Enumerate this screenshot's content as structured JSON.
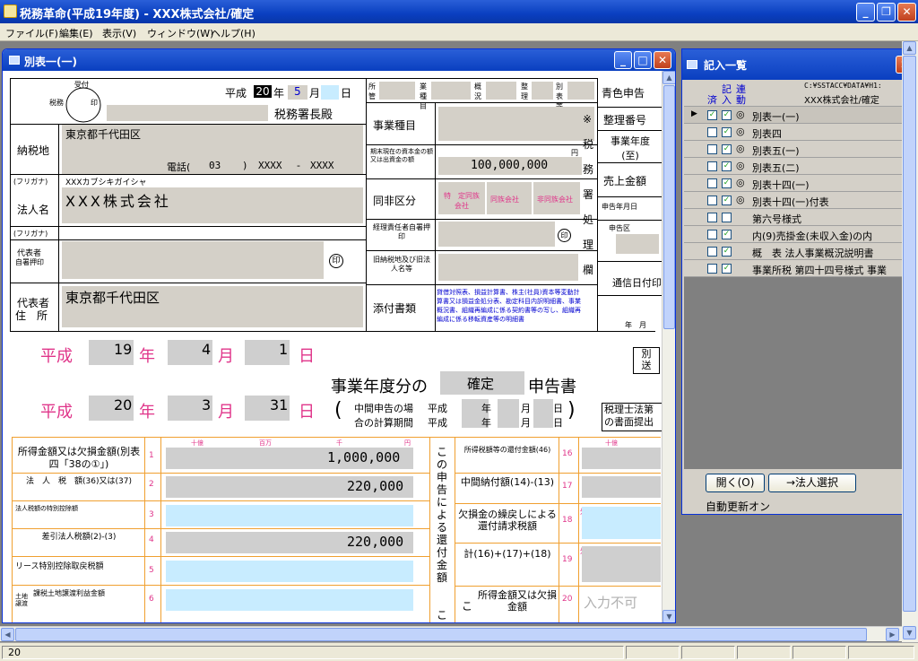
{
  "app": {
    "title": "税務革命(平成19年度) - XXX株式会社/確定"
  },
  "menu": [
    "ファイル(F)",
    "編集(E)",
    "表示(V)",
    "ウィンドウ(W)",
    "ヘルプ(H)"
  ],
  "child": {
    "title": "別表一(一)"
  },
  "header": {
    "era": "平成",
    "year": "20",
    "nen": "年",
    "month": "5",
    "gatsu": "月",
    "day_label": "日",
    "tax_office": "税務署長殿",
    "stamp": {
      "top": "受付",
      "left": "税務",
      "right": "印"
    }
  },
  "taxpayer": {
    "address_label": "納税地",
    "address": "東京都千代田区",
    "phone_label": "電話(",
    "phone1": "03",
    "phone_mid": ")",
    "phone2": "XXXX",
    "phone_dash": "-",
    "phone3": "XXXX",
    "furigana_label": "(フリガナ)",
    "furigana": "XXXカブシキガイシャ",
    "corp_label": "法人名",
    "corp_name": "XXX株式会社",
    "furigana_label2": "(フリガナ)",
    "rep_label1": "代表者",
    "rep_label2": "自署押印",
    "rep_seal": "印",
    "rep_addr_label1": "代表者",
    "rep_addr_label2": "住　所",
    "rep_addr": "東京都千代田区"
  },
  "middle": {
    "business_type": "事業種目",
    "capital_label": "期末現在の資本金の額又は出資金の額",
    "capital_unit": "円",
    "capital": "100,000,000",
    "same_label": "同非区分",
    "same_options": [
      "特　定同族会社",
      "同族会社",
      "非同族会社"
    ],
    "officer_label": "経理責任者自署押印",
    "officer_seal": "印",
    "former_label": "旧納税地及び旧法人名等",
    "attach_label": "添付書類",
    "attach_text": "貸借対照表、損益計算書、株主(社員)資本等変動計算書又は損益金処分表、勘定科目内訳明細書、事業概況書、組織再編成に係る契約書等の写し、組織再編成に係る移転資産等の明細書"
  },
  "topcodes": [
    "所管",
    "業種目",
    "概況",
    "整理",
    "別表等"
  ],
  "right": {
    "col": [
      "※",
      "税",
      "務",
      "署",
      "処",
      "理",
      "欄"
    ],
    "cells": [
      "青色申告",
      "整理番号",
      "事業年度(至)",
      "売上金額",
      "申告年月日",
      "申告区",
      "",
      "通信日付印",
      "年　月"
    ]
  },
  "period": {
    "era1": "平成",
    "y1": "19",
    "nen1": "年",
    "m1": "4",
    "gatsu1": "月",
    "d1": "1",
    "nichi1": "日",
    "era2": "平成",
    "y2": "20",
    "nen2": "年",
    "m2": "3",
    "gatsu2": "月",
    "d2": "31",
    "nichi2": "日",
    "bunbu": "事業年度分の",
    "kind": "確定",
    "kind_suffix": "申告書",
    "interim1": "中間申告の場",
    "interim2": "合の計算期間",
    "heisei_a": "平成",
    "heisei_b": "平成",
    "nen_a": "年",
    "tsuki_a": "月",
    "hi_a": "日",
    "nen_b": "年",
    "tsuki_b": "月",
    "hi_b": "日",
    "betsu": "別",
    "sou": "送",
    "rishi1": "税理士法第",
    "rishi2": "の書面提出"
  },
  "units": [
    "十億",
    "百万",
    "千",
    "円"
  ],
  "units_right": "十億",
  "lines": [
    {
      "label": "所得金額又は欠損金額(別表四「38の①」)",
      "no": "1",
      "value": "1,000,000"
    },
    {
      "label": "法　人　税　額(36)又は(37)",
      "no": "2",
      "value": "220,000"
    },
    {
      "label": "法人税額の特別控除額",
      "no": "3",
      "value": ""
    },
    {
      "label": "差引法人税額(2)-(3)",
      "no": "4",
      "value": "220,000"
    },
    {
      "label": "リース特別控除取戻税額",
      "no": "5",
      "value": ""
    },
    {
      "label": "課税土地譲渡利益金額",
      "no": "6",
      "value": ""
    }
  ],
  "lines_side_label": "土地譲渡",
  "refund": {
    "vertical": [
      "こ",
      "の",
      "申",
      "告",
      "に",
      "よ",
      "る",
      "還",
      "付",
      "金",
      "額"
    ],
    "rows": [
      {
        "label": "所得税額等の還付金額(46)",
        "no": "16"
      },
      {
        "label": "中間納付額(14)-(13)",
        "no": "17"
      },
      {
        "label": "欠損金の繰戻しによる還付請求税額",
        "no": "18",
        "prefix": "外"
      },
      {
        "label": "計(16)+(17)+(18)",
        "no": "19",
        "prefix": "外"
      },
      {
        "label": "所得金額又は欠損金額",
        "no": "20",
        "value": "入力不可"
      }
    ],
    "bottom_ko": "こ",
    "bottom_ko2": "こ"
  },
  "entry": {
    "title": "記入一覧",
    "col1": "記",
    "col2": "連",
    "col3": "済",
    "col4": "入",
    "col5": "動",
    "path": "C:¥SSTACC¥DATA¥H1:",
    "company": "XXX株式会社/確定",
    "items": [
      {
        "name": "別表一(一)",
        "mark": "◎",
        "c1": "✓",
        "c2": "✓"
      },
      {
        "name": "別表四",
        "mark": "◎",
        "c1": "",
        "c2": "✓"
      },
      {
        "name": "別表五(一)",
        "mark": "◎",
        "c1": "",
        "c2": "✓"
      },
      {
        "name": "別表五(二)",
        "mark": "◎",
        "c1": "",
        "c2": "✓"
      },
      {
        "name": "別表十四(一)",
        "mark": "◎",
        "c1": "",
        "c2": "✓"
      },
      {
        "name": "別表十四(一)付表",
        "mark": "◎",
        "c1": "",
        "c2": "✓"
      },
      {
        "name": "第六号様式",
        "mark": "",
        "c1": "",
        "c2": ""
      },
      {
        "name": "内(9)売掛金(未収入金)の内",
        "mark": "",
        "c1": "",
        "c2": "✓"
      },
      {
        "name": "概　表 法人事業概況説明書",
        "mark": "",
        "c1": "",
        "c2": "✓"
      },
      {
        "name": "事業所税 第四十四号様式 事業",
        "mark": "",
        "c1": "",
        "c2": "✓"
      }
    ],
    "open_btn": "開く(O)",
    "select_btn": "→法人選択",
    "auto_update": "自動更新オン"
  },
  "status": {
    "text": "20"
  }
}
